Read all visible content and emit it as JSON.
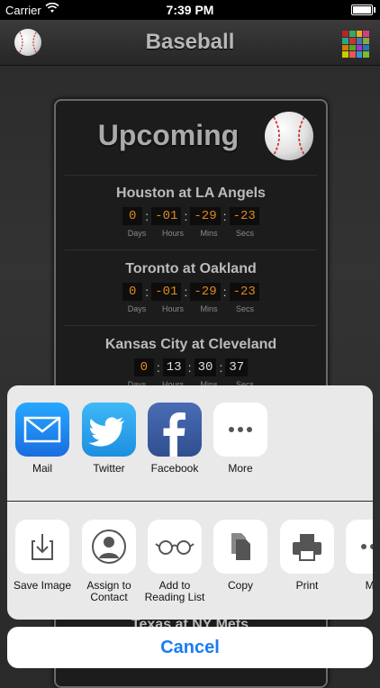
{
  "status": {
    "carrier": "Carrier",
    "time": "7:39 PM",
    "battery_level": 1.0
  },
  "nav": {
    "title": "Baseball",
    "grid_colors": [
      "#b22",
      "#3a6",
      "#e8b020",
      "#d04080",
      "#2a8",
      "#c33",
      "#47a",
      "#8a4",
      "#d70",
      "#5a2",
      "#a3c",
      "#27b",
      "#cc0",
      "#e55",
      "#39c",
      "#7b3"
    ]
  },
  "card": {
    "heading": "Upcoming",
    "games": [
      {
        "name": "Houston at LA Angels",
        "days": "0",
        "hours": "-01",
        "mins": "-29",
        "secs": "-23"
      },
      {
        "name": "Toronto at Oakland",
        "days": "0",
        "hours": "-01",
        "mins": "-29",
        "secs": "-23"
      },
      {
        "name": "Kansas City at Cleveland",
        "days": "0",
        "hours": "13",
        "mins": "30",
        "secs": "37"
      }
    ],
    "labels": {
      "days": "Days",
      "hours": "Hours",
      "mins": "Mins",
      "secs": "Secs"
    },
    "partial_game": "Texas at NY Mets"
  },
  "share": {
    "apps": [
      {
        "label": "Mail",
        "icon": "mail-icon",
        "color": "#1a8cf5"
      },
      {
        "label": "Twitter",
        "icon": "twitter-icon",
        "color": "#2aa3ef"
      },
      {
        "label": "Facebook",
        "icon": "facebook-icon",
        "color": "#3b5998"
      },
      {
        "label": "More",
        "icon": "more-icon",
        "color": "#ffffff"
      }
    ],
    "actions": [
      {
        "label": "Save Image",
        "icon": "save-image-icon"
      },
      {
        "label": "Assign to Contact",
        "icon": "contact-icon"
      },
      {
        "label": "Add to Reading List",
        "icon": "glasses-icon"
      },
      {
        "label": "Copy",
        "icon": "copy-icon"
      },
      {
        "label": "Print",
        "icon": "print-icon"
      },
      {
        "label": "Mo",
        "icon": "more-icon"
      }
    ],
    "cancel": "Cancel"
  }
}
